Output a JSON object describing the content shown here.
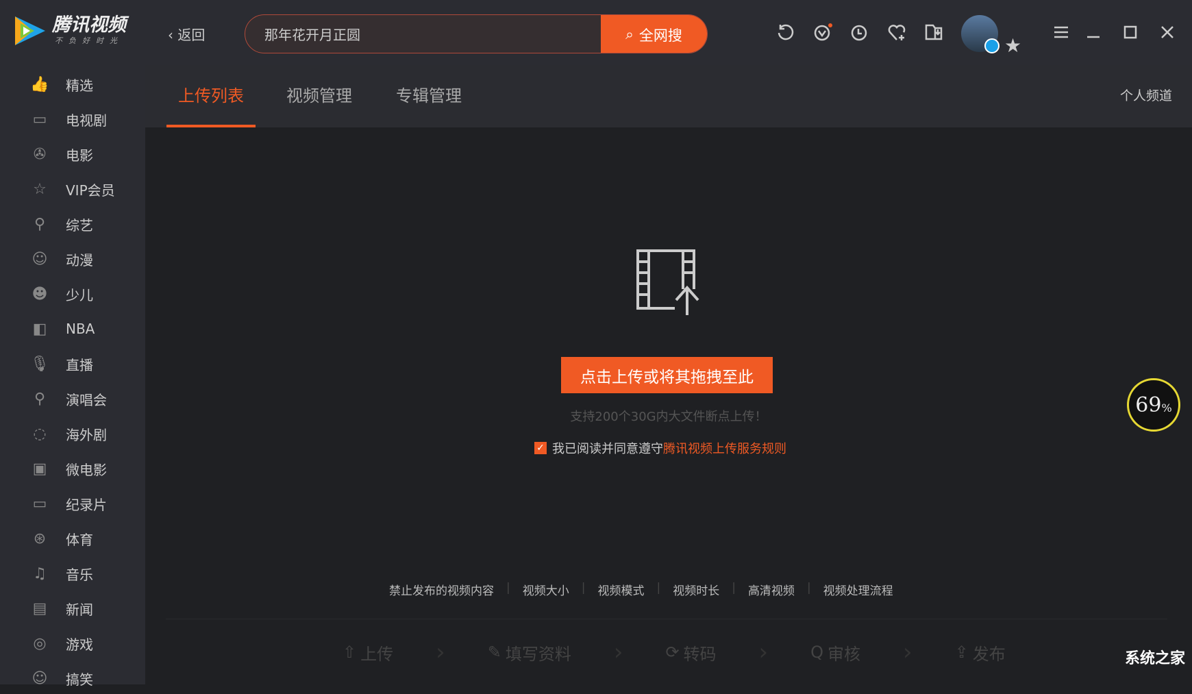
{
  "app": {
    "name": "腾讯视频",
    "slogan": "不负好时光",
    "back": "返回"
  },
  "search": {
    "value": "那年花开月正圆",
    "button": "全网搜"
  },
  "toolbar": {
    "icons": [
      "refresh-icon",
      "vip-icon",
      "history-icon",
      "favorite-icon",
      "download-icon"
    ],
    "window": [
      "menu-icon",
      "minimize-icon",
      "maximize-icon",
      "close-icon"
    ]
  },
  "sidebar": {
    "items": [
      {
        "label": "精选",
        "icon": "👍"
      },
      {
        "label": "电视剧",
        "icon": "▭"
      },
      {
        "label": "电影",
        "icon": "✇"
      },
      {
        "label": "VIP会员",
        "icon": "☆"
      },
      {
        "label": "综艺",
        "icon": "⚲"
      },
      {
        "label": "动漫",
        "icon": "☺"
      },
      {
        "label": "少儿",
        "icon": "☻"
      },
      {
        "label": "NBA",
        "icon": "◧"
      },
      {
        "label": "直播",
        "icon": "🎙"
      },
      {
        "label": "演唱会",
        "icon": "⚲"
      },
      {
        "label": "海外剧",
        "icon": "◌"
      },
      {
        "label": "微电影",
        "icon": "▣"
      },
      {
        "label": "纪录片",
        "icon": "▭"
      },
      {
        "label": "体育",
        "icon": "⊛"
      },
      {
        "label": "音乐",
        "icon": "♫"
      },
      {
        "label": "新闻",
        "icon": "▤"
      },
      {
        "label": "游戏",
        "icon": "◎"
      },
      {
        "label": "搞笑",
        "icon": "☺"
      }
    ]
  },
  "tabs": [
    {
      "label": "上传列表",
      "active": true
    },
    {
      "label": "视频管理"
    },
    {
      "label": "专辑管理"
    }
  ],
  "personal_channel": "个人频道",
  "upload": {
    "button": "点击上传或将其拖拽至此",
    "hint": "支持200个30G内大文件断点上传！",
    "agree_text": "我已阅读并同意遵守",
    "agree_link": "腾讯视频上传服务规则",
    "checked": true
  },
  "links": [
    "禁止发布的视频内容",
    "视频大小",
    "视频模式",
    "视频时长",
    "高清视频",
    "视频处理流程"
  ],
  "steps": [
    {
      "label": "上传",
      "icon": "⇧"
    },
    {
      "label": "填写资料",
      "icon": "✎"
    },
    {
      "label": "转码",
      "icon": "⟳"
    },
    {
      "label": "审核",
      "icon": "Q"
    },
    {
      "label": "发布",
      "icon": "⇪"
    }
  ],
  "overlay": {
    "percent": "69",
    "unit": "%"
  },
  "watermark": "系统之家",
  "colors": {
    "accent": "#f05a24"
  }
}
